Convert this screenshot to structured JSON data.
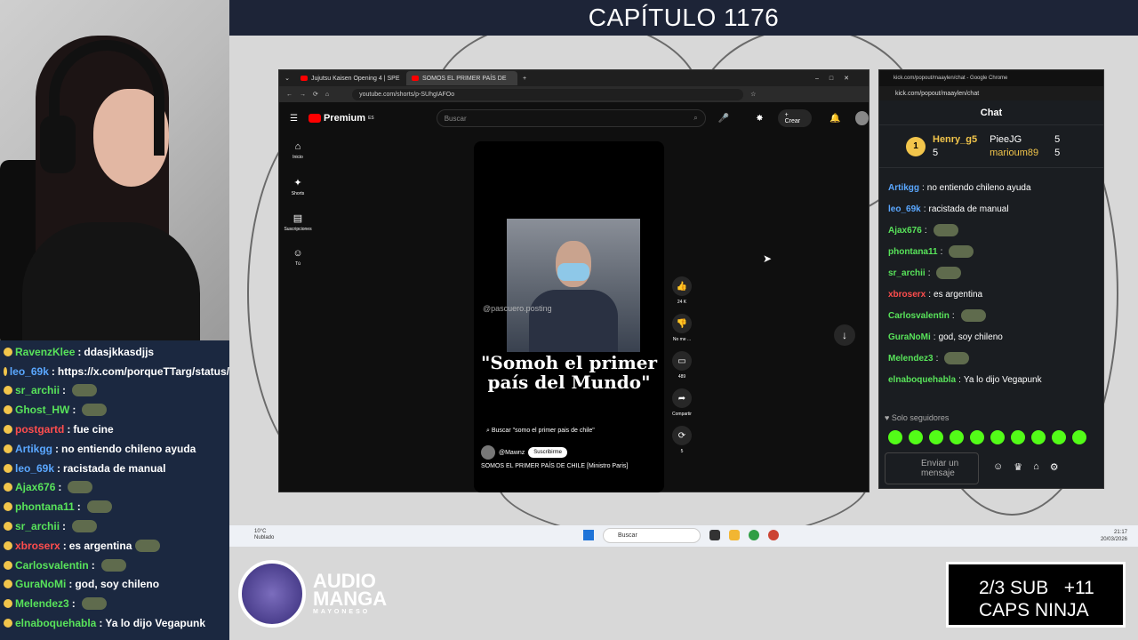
{
  "header": {
    "title": "CAPÍTULO 1176"
  },
  "stream_chat": [
    {
      "user": "RavenzKlee",
      "color": "#58e35a",
      "msg": "ddasjkkasdjjs",
      "emote": false
    },
    {
      "user": "leo_69k",
      "color": "#5aa7ff",
      "msg": "https://x.com/porqueTTarg/status/",
      "emote": false
    },
    {
      "user": "sr_archii",
      "color": "#58e35a",
      "msg": "",
      "emote": true
    },
    {
      "user": "Ghost_HW",
      "color": "#58e35a",
      "msg": "",
      "emote": true
    },
    {
      "user": "postgartd",
      "color": "#ff4d4d",
      "msg": "fue cine",
      "emote": false
    },
    {
      "user": "Artikgg",
      "color": "#5aa7ff",
      "msg": "no entiendo chileno ayuda",
      "emote": false
    },
    {
      "user": "leo_69k",
      "color": "#5aa7ff",
      "msg": "racistada de manual",
      "emote": false
    },
    {
      "user": "Ajax676",
      "color": "#58e35a",
      "msg": "",
      "emote": true
    },
    {
      "user": "phontana11",
      "color": "#58e35a",
      "msg": "",
      "emote": true
    },
    {
      "user": "sr_archii",
      "color": "#58e35a",
      "msg": "",
      "emote": true
    },
    {
      "user": "xbroserx",
      "color": "#ff4d4d",
      "msg": "es argentina",
      "emote": true
    },
    {
      "user": "Carlosvalentin",
      "color": "#58e35a",
      "msg": "",
      "emote": true
    },
    {
      "user": "GuraNoMi",
      "color": "#58e35a",
      "msg": "god, soy chileno",
      "emote": false
    },
    {
      "user": "Melendez3",
      "color": "#58e35a",
      "msg": "",
      "emote": true
    },
    {
      "user": "elnaboquehabla",
      "color": "#58e35a",
      "msg": "Ya lo dijo Vegapunk",
      "emote": false
    }
  ],
  "youtube": {
    "tabs": [
      "Jujutsu Kaisen Opening 4 | SPE",
      "SOMOS EL PRIMER PAÍS DE"
    ],
    "url": "youtube.com/shorts/p-SUhgIAFOo",
    "logo": "Premium",
    "logo_sup": "ES",
    "search_placeholder": "Buscar",
    "create_label": "Crear",
    "sidebar": [
      {
        "icon": "home-icon",
        "glyph": "⌂",
        "label": "Inicio"
      },
      {
        "icon": "shorts-icon",
        "glyph": "✦",
        "label": "Shorts"
      },
      {
        "icon": "subscriptions-icon",
        "glyph": "▤",
        "label": "Suscripciones"
      },
      {
        "icon": "you-icon",
        "glyph": "☺",
        "label": "Tú"
      }
    ],
    "short": {
      "watermark": "@pascuero.posting",
      "caption_line1": "\"Somoh el primer",
      "caption_line2": "país del Mundo\"",
      "search_suggestion": "Buscar \"somo el primer pais de chile\"",
      "channel": "@Mawnz",
      "subscribe": "Suscribirme",
      "description": "SOMOS EL PRIMER PAÍS DE CHILE [Ministro Paris]"
    },
    "actions": [
      {
        "icon": "like-icon",
        "glyph": "👍",
        "label": "24 K"
      },
      {
        "icon": "dislike-icon",
        "glyph": "👎",
        "label": "No me ..."
      },
      {
        "icon": "comment-icon",
        "glyph": "▭",
        "label": "489"
      },
      {
        "icon": "share-icon",
        "glyph": "➦",
        "label": "Compartir"
      },
      {
        "icon": "remix-icon",
        "glyph": "⟳",
        "label": "5"
      }
    ]
  },
  "kick": {
    "window_title": "kick.com/popout/maaylen/chat - Google Chrome",
    "url": "kick.com/popout/maaylen/chat",
    "header": "Chat",
    "leaderboard": [
      {
        "rank": "1",
        "name": "Henry_g5",
        "count": "5"
      },
      {
        "name": "PieeJG",
        "count": "5"
      },
      {
        "name": "marioum89",
        "count": "5"
      }
    ],
    "messages": [
      {
        "user": "Artikgg",
        "color": "#5aa7ff",
        "msg": "no entiendo chileno ayuda"
      },
      {
        "user": "leo_69k",
        "color": "#5aa7ff",
        "msg": "racistada de manual"
      },
      {
        "user": "Ajax676",
        "color": "#58e35a",
        "msg": ""
      },
      {
        "user": "phontana11",
        "color": "#58e35a",
        "msg": ""
      },
      {
        "user": "sr_archii",
        "color": "#58e35a",
        "msg": ""
      },
      {
        "user": "xbroserx",
        "color": "#ff4d4d",
        "msg": "es argentina"
      },
      {
        "user": "Carlosvalentin",
        "color": "#58e35a",
        "msg": ""
      },
      {
        "user": "GuraNoMi",
        "color": "#58e35a",
        "msg": "god, soy chileno"
      },
      {
        "user": "Melendez3",
        "color": "#58e35a",
        "msg": ""
      },
      {
        "user": "elnaboquehabla",
        "color": "#58e35a",
        "msg": "Ya lo dijo Vegapunk"
      }
    ],
    "follower_mode": "Solo seguidores",
    "input_placeholder": "Enviar un mensaje"
  },
  "taskbar": {
    "weather_temp": "10°C",
    "weather_desc": "Nublado",
    "search": "Buscar",
    "time": "21:17",
    "date": "20/03/2026"
  },
  "overlay": {
    "logo_line1": "AUDIO",
    "logo_line2": "MANGA",
    "logo_line3": "MAYONESO",
    "goal_line1": "2/3 SUB   +11",
    "goal_line2": "CAPS NINJA"
  }
}
